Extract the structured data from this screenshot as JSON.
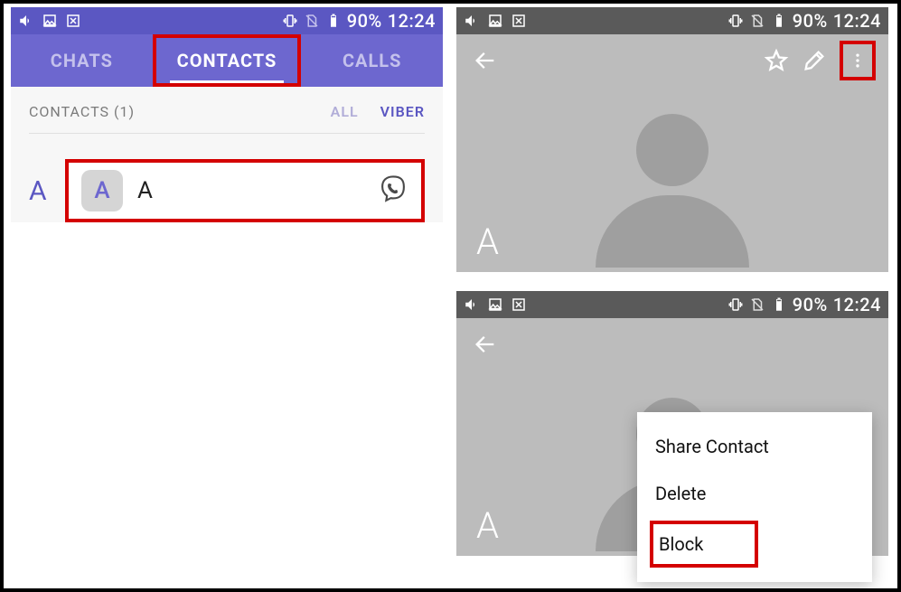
{
  "statusbar": {
    "battery_text": "90%",
    "time": "12:24"
  },
  "panel1": {
    "tabs": {
      "chats": "CHATS",
      "contacts": "CONTACTS",
      "calls": "CALLS"
    },
    "header_label": "CONTACTS (1)",
    "filter_all": "ALL",
    "filter_viber": "VIBER",
    "section_letter": "A",
    "contact": {
      "avatar_letter": "A",
      "name": "A"
    }
  },
  "panel2": {
    "corner_letter": "A"
  },
  "panel3": {
    "corner_letter": "A",
    "menu": {
      "share": "Share Contact",
      "delete": "Delete",
      "block": "Block"
    }
  }
}
